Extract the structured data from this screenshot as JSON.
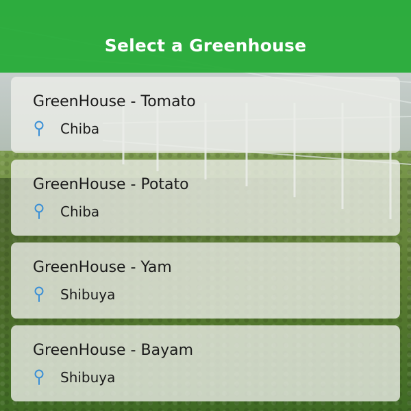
{
  "header": {
    "title": "Select a Greenhouse",
    "color": "#22aa34"
  },
  "greenhouses": [
    {
      "name": "GreenHouse - Tomato",
      "location": "Chiba",
      "icon": "location-pin-icon"
    },
    {
      "name": "GreenHouse - Potato",
      "location": "Chiba",
      "icon": "location-pin-icon"
    },
    {
      "name": "GreenHouse - Yam",
      "location": "Shibuya",
      "icon": "location-pin-icon"
    },
    {
      "name": "GreenHouse - Bayam",
      "location": "Shibuya",
      "icon": "location-pin-icon"
    }
  ],
  "colors": {
    "pin": "#3a8fd6",
    "card_text": "#1b1b1b"
  }
}
